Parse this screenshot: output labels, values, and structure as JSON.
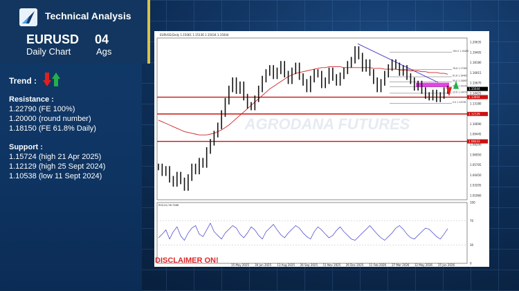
{
  "header": {
    "brand": "Technical Analysis",
    "pair": "EURUSD",
    "timeframe": "Daily Chart",
    "day": "04",
    "month": "Ags"
  },
  "trend": {
    "label": "Trend :",
    "icons": [
      "red-down-arrow-icon",
      "green-up-arrow-icon"
    ]
  },
  "resistance": {
    "title": "Resistance :",
    "items": [
      "1.22790 (FE 100%)",
      "1.20000 (round number)",
      "1.18150 (FE 61.8% Daily)"
    ]
  },
  "support": {
    "title": "Support :",
    "items": [
      "1.15724 (high 21 Apr 2025)",
      "1.12129 (high 25 Sept 2024)",
      "1.10538 (low 11 Sept 2024)"
    ]
  },
  "disclaimer": "DISCLAIMER ON!",
  "chart_data": {
    "type": "line",
    "title": "EURUSD,Daily  1.15061 1.15136 1.15034 1.15044",
    "watermark": "AGRODANA FUTURES",
    "price_ticks": [
      "1.20635",
      "1.19405",
      "1.18180",
      "1.16915",
      "1.15670",
      "1.14425",
      "1.13180",
      "1.11935",
      "1.10690",
      "1.09445",
      "1.08200",
      "1.06950",
      "1.05705",
      "1.04450",
      "1.03205",
      "1.01960"
    ],
    "x_ticks": [
      "15 May 2025",
      "30 Jun 2025",
      "13 Aug 2025",
      "26 Sep 2025",
      "11 Nov 2025",
      "26 Dec 2025",
      "11 Feb 2026",
      "27 Mar 2026",
      "12 May 2026",
      "25 Jun 2026"
    ],
    "ylim": [
      1.015,
      1.212
    ],
    "current_price_label": "1.15044",
    "horizontal_levels": [
      {
        "value": 1.14,
        "label": "1.13904",
        "color": "#cc1111"
      },
      {
        "value": 1.1195,
        "label": "1.12129",
        "color": "#cc1111"
      },
      {
        "value": 1.0861,
        "label": "1.08433",
        "color": "#cc1111"
      }
    ],
    "fib_levels": [
      {
        "label": "100.0",
        "value": 1.19485
      },
      {
        "label": "78.6",
        "value": 1.17382
      },
      {
        "label": "61.8",
        "value": 1.16483
      },
      {
        "label": "50.0",
        "value": 1.15863
      },
      {
        "label": "38.2",
        "value": 1.15243
      },
      {
        "label": "23.6",
        "value": 1.14474
      },
      {
        "label": "0.0",
        "value": 1.13236
      }
    ],
    "close_series": [
      1.055,
      1.048,
      1.052,
      1.04,
      1.035,
      1.045,
      1.038,
      1.03,
      1.042,
      1.055,
      1.05,
      1.062,
      1.058,
      1.075,
      1.085,
      1.095,
      1.105,
      1.12,
      1.135,
      1.15,
      1.16,
      1.148,
      1.155,
      1.14,
      1.13,
      1.128,
      1.138,
      1.15,
      1.162,
      1.17,
      1.175,
      1.166,
      1.172,
      1.18,
      1.168,
      1.16,
      1.172,
      1.178,
      1.165,
      1.158,
      1.15,
      1.162,
      1.17,
      1.168,
      1.155,
      1.16,
      1.172,
      1.164,
      1.158,
      1.166,
      1.172,
      1.18,
      1.185,
      1.198,
      1.19,
      1.175,
      1.182,
      1.17,
      1.16,
      1.15,
      1.158,
      1.168,
      1.176,
      1.182,
      1.178,
      1.17,
      1.175,
      1.165,
      1.16,
      1.152,
      1.156,
      1.148,
      1.142,
      1.14,
      1.145,
      1.138,
      1.142,
      1.148,
      1.15
    ],
    "ma_series": [
      1.112,
      1.11,
      1.108,
      1.106,
      1.104,
      1.102,
      1.1,
      1.098,
      1.097,
      1.096,
      1.095,
      1.094,
      1.094,
      1.094,
      1.095,
      1.096,
      1.098,
      1.1,
      1.103,
      1.106,
      1.11,
      1.114,
      1.118,
      1.122,
      1.126,
      1.13,
      1.134,
      1.138,
      1.142,
      1.146,
      1.15,
      1.153,
      1.156,
      1.159,
      1.162,
      1.165,
      1.167,
      1.169,
      1.17,
      1.171,
      1.172,
      1.173,
      1.174,
      1.175,
      1.176,
      1.176,
      1.177,
      1.177,
      1.177,
      1.177,
      1.176,
      1.176,
      1.176,
      1.176,
      1.176,
      1.176,
      1.176,
      1.176,
      1.175,
      1.175,
      1.175,
      1.174,
      1.174,
      1.174,
      1.174,
      1.173,
      1.173,
      1.173,
      1.172,
      1.172,
      1.172,
      1.171,
      1.171,
      1.17,
      1.17,
      1.17,
      1.169,
      1.169,
      1.168
    ],
    "rsi": {
      "label": "RSI(14) 56.7466",
      "y_ticks": [
        "100",
        "70",
        "30",
        "0"
      ],
      "ylim": [
        0,
        100
      ],
      "values": [
        42,
        48,
        55,
        40,
        52,
        60,
        45,
        38,
        50,
        58,
        62,
        48,
        44,
        55,
        66,
        52,
        46,
        40,
        50,
        56,
        62,
        58,
        48,
        42,
        50,
        60,
        55,
        46,
        40,
        52,
        58,
        64,
        55,
        47,
        42,
        50,
        56,
        62,
        58,
        50,
        44,
        40,
        52,
        60,
        55,
        48,
        42,
        46,
        54,
        60,
        52,
        46,
        40,
        38,
        44,
        50,
        56,
        62,
        55,
        48,
        42,
        38,
        44,
        50,
        58,
        62,
        56,
        48,
        42,
        40,
        46,
        52,
        58,
        56,
        50,
        44,
        40,
        48,
        57
      ]
    }
  }
}
